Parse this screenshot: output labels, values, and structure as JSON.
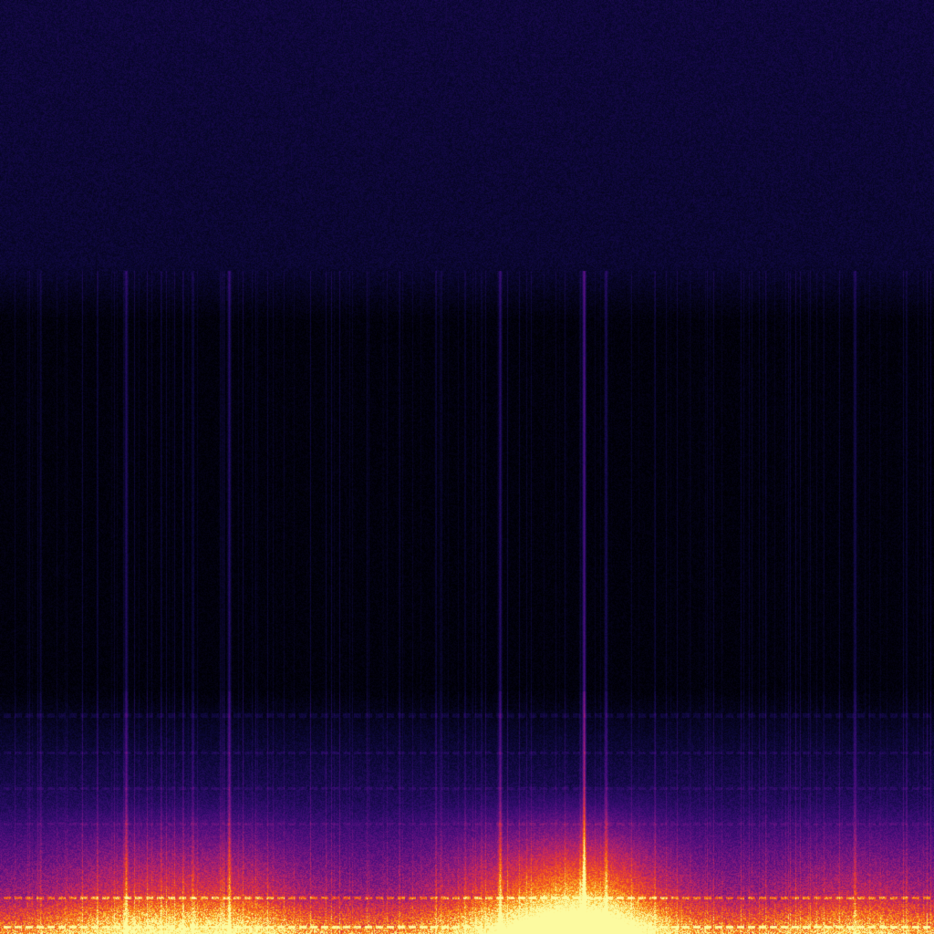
{
  "image": {
    "kind": "spectrogram",
    "colormap": "inferno",
    "colors": {
      "background_top": "#0c0838",
      "background_mid": "#000008",
      "noise_band": "#3a1a7a",
      "transient": "#7a2aa8",
      "low_band": "#c8128a",
      "bass_band": "#f0202a",
      "peak": "#ffe070"
    },
    "transients": [
      {
        "time_fraction": 0.135,
        "strength": 0.55
      },
      {
        "time_fraction": 0.245,
        "strength": 0.6
      },
      {
        "time_fraction": 0.535,
        "strength": 0.6
      },
      {
        "time_fraction": 0.625,
        "strength": 1.0
      },
      {
        "time_fraction": 0.648,
        "strength": 0.45
      },
      {
        "time_fraction": 0.915,
        "strength": 0.4
      }
    ]
  }
}
